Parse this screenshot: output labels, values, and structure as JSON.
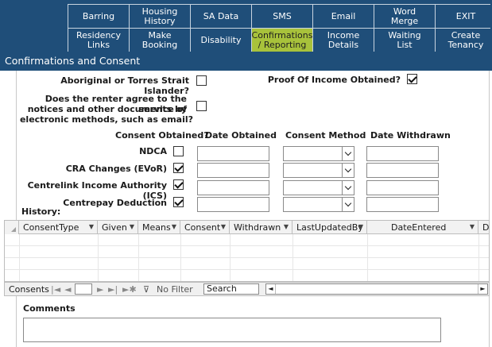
{
  "nav": {
    "row1": [
      "Barring",
      "Housing\nHistory",
      "SA Data",
      "SMS",
      "Email",
      "Word\nMerge",
      "EXIT"
    ],
    "row2": [
      "Residency\nLinks",
      "Make\nBooking",
      "Disability",
      "Confirmations\n/ Reporting",
      "Income\nDetails",
      "Waiting\nList",
      "Create\nTenancy"
    ],
    "active": "Confirmations\n/ Reporting",
    "bar_color": "#1f4e79",
    "active_color": "#a8c23b"
  },
  "form": {
    "title": "Confirmations and Consent",
    "aboriginal_label": "Aboriginal or Torres Strait Islander?",
    "aboriginal_checked": false,
    "proof_income_label": "Proof Of Income Obtained?",
    "proof_income_checked": true,
    "electronic_label_1": "Does the renter agree to the service of",
    "electronic_label_2": "notices and other documents by",
    "electronic_label_3": "electronic methods, such as email?",
    "electronic_checked": false,
    "headers": {
      "consent_obtained": "Consent Obtained?",
      "date_obtained": "Date Obtained",
      "consent_method": "Consent Method",
      "date_withdrawn": "Date Withdrawn"
    },
    "consents": [
      {
        "label": "NDCA",
        "checked": false,
        "date_obtained": "",
        "method": "",
        "date_withdrawn": ""
      },
      {
        "label": "CRA Changes (EVoR)",
        "checked": true,
        "date_obtained": "",
        "method": "",
        "date_withdrawn": ""
      },
      {
        "label": "Centrelink Income Authority (ICS)",
        "checked": true,
        "date_obtained": "",
        "method": "",
        "date_withdrawn": ""
      },
      {
        "label": "Centrepay Deduction",
        "checked": true,
        "date_obtained": "",
        "method": "",
        "date_withdrawn": ""
      }
    ],
    "history_label": "History:",
    "comments_label": "Comments",
    "comments_value": ""
  },
  "grid": {
    "columns": [
      "ConsentType",
      "Given",
      "Means",
      "Consent",
      "Withdrawn",
      "LastUpdatedBy",
      "DateEntered",
      "D"
    ],
    "rows": []
  },
  "recordnav": {
    "label": "Consents",
    "current": "",
    "filter_label": "No Filter",
    "search_placeholder": "Search"
  }
}
